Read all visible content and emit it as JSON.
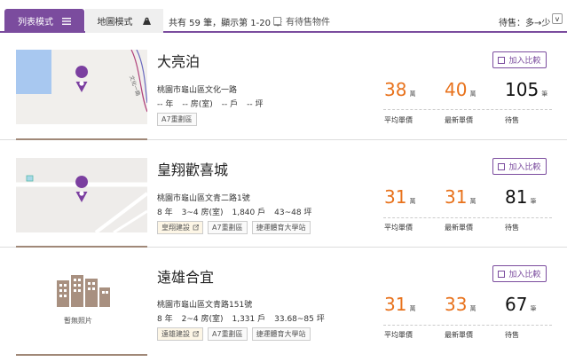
{
  "toolbar": {
    "list_tab": "列表模式",
    "map_tab": "地圖模式",
    "summary": "共有 59 筆，顯示第 1-20 筆",
    "pending_label": "有待售物件",
    "sort_label": "待售：多→少",
    "sort_arrow": "v"
  },
  "listings": [
    {
      "name": "大亮泊",
      "address": "桃園市龜山區文化一路",
      "specs": [
        "-- 年",
        "-- 房(室)",
        "-- 戶",
        "-- 坪"
      ],
      "tags": [
        {
          "label": "A7重劃區",
          "type": "zone"
        }
      ],
      "compare_label": "加入比較",
      "avg_price": "38",
      "latest_price": "40",
      "for_sale": "105",
      "price_unit": "萬",
      "count_unit": "筆",
      "avg_label": "平均單價",
      "latest_label": "最新單價",
      "sale_label": "待售",
      "thumb": "map"
    },
    {
      "name": "皇翔歡喜城",
      "address": "桃園市龜山區文青二路1號",
      "specs": [
        "8 年",
        "3~4 房(室)",
        "1,840 戶",
        "43~48 坪"
      ],
      "tags": [
        {
          "label": "皇翔建設",
          "type": "builder"
        },
        {
          "label": "A7重劃區",
          "type": "zone"
        },
        {
          "label": "捷運體育大學站",
          "type": "zone"
        }
      ],
      "compare_label": "加入比較",
      "avg_price": "31",
      "latest_price": "31",
      "for_sale": "81",
      "price_unit": "萬",
      "count_unit": "筆",
      "avg_label": "平均單價",
      "latest_label": "最新單價",
      "sale_label": "待售",
      "thumb": "map2"
    },
    {
      "name": "遠雄合宜",
      "address": "桃園市龜山區文青路151號",
      "specs": [
        "8 年",
        "2~4 房(室)",
        "1,331 戶",
        "33.68~85 坪"
      ],
      "tags": [
        {
          "label": "遠雄建設",
          "type": "builder"
        },
        {
          "label": "A7重劃區",
          "type": "zone"
        },
        {
          "label": "捷運體育大學站",
          "type": "zone"
        }
      ],
      "compare_label": "加入比較",
      "avg_price": "31",
      "latest_price": "33",
      "for_sale": "67",
      "price_unit": "萬",
      "count_unit": "筆",
      "avg_label": "平均單價",
      "latest_label": "最新單價",
      "sale_label": "待售",
      "thumb": "nophoto",
      "no_photo_label": "暫無照片"
    }
  ],
  "map_street_label": "文化一路",
  "colors": {
    "accent": "#7b4c9e",
    "price_orange": "#e8721c"
  }
}
